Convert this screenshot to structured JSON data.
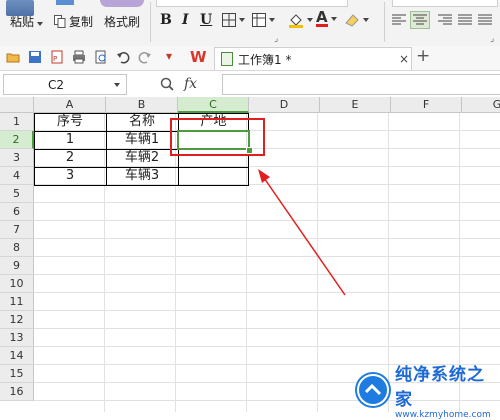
{
  "ribbon": {
    "paste_label": "粘贴",
    "copy_label": "复制",
    "format_painter_label": "格式刷",
    "bold": "B",
    "italic": "I",
    "underline": "U",
    "font_color_glyph": "A"
  },
  "document_tab": {
    "title": "工作簿1 *",
    "close": "×",
    "new_tab": "+"
  },
  "formula_bar": {
    "name_box": "C2",
    "fx_label": "fx",
    "formula_value": ""
  },
  "sheet": {
    "columns": [
      "A",
      "B",
      "C",
      "D",
      "E",
      "F",
      "G"
    ],
    "rows": [
      "1",
      "2",
      "3",
      "4",
      "5",
      "6",
      "7",
      "8",
      "9",
      "10",
      "11",
      "12",
      "13",
      "14",
      "15",
      "16"
    ],
    "selected_column": "C",
    "selected_row": "2",
    "table": {
      "headers": [
        "序号",
        "名称",
        "产地"
      ],
      "rows": [
        [
          "1",
          "车辆1",
          ""
        ],
        [
          "2",
          "车辆2",
          ""
        ],
        [
          "3",
          "车辆3",
          ""
        ]
      ]
    }
  },
  "annotation_color": "#e02020",
  "accent_color": "#4f9a3e",
  "watermark": {
    "title": "纯净系统之家",
    "url": "www.kzmyhome.com"
  }
}
